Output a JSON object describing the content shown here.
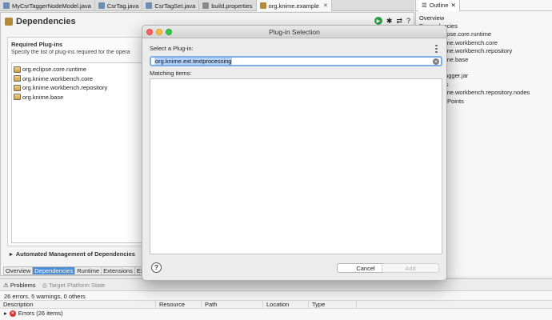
{
  "editor_tabs": [
    {
      "label": "MyCsrTaggerNodeModel.java",
      "icon": "java-file-icon"
    },
    {
      "label": "CsrTag.java",
      "icon": "java-file-icon"
    },
    {
      "label": "CsrTagSet.java",
      "icon": "java-file-icon"
    },
    {
      "label": "build.properties",
      "icon": "properties-file-icon"
    },
    {
      "label": "org.knime.example",
      "icon": "plugin-manifest-icon",
      "active": true
    }
  ],
  "editor": {
    "title": "Dependencies",
    "required_section": {
      "title": "Required Plug-ins",
      "description": "Specify the list of plug-ins required for the opera",
      "plugins": [
        "org.eclipse.core.runtime",
        "org.knime.workbench.core",
        "org.knime.workbench.repository",
        "org.knime.base"
      ]
    },
    "auto_management": "Automated Management of Dependencies",
    "page_tabs": [
      "Overview",
      "Dependencies",
      "Runtime",
      "Extensions",
      "Ex"
    ]
  },
  "outline": {
    "tab_label": "Outline",
    "nodes": [
      {
        "label": "Overview",
        "level": 1
      },
      {
        "label": "Dependencies",
        "level": 1
      },
      {
        "label": "org.eclipse.core.runtime",
        "level": 2
      },
      {
        "label": "org.knime.workbench.core",
        "level": 2
      },
      {
        "label": "org.knime.workbench.repository",
        "level": 2
      },
      {
        "label": "org.knime.base",
        "level": 2
      },
      {
        "label": "Runtime",
        "level": 1
      },
      {
        "label": "mycsrtagger.jar",
        "level": 2
      },
      {
        "label": "Extensions",
        "level": 1
      },
      {
        "label": "org.knime.workbench.repository.nodes",
        "level": 2
      },
      {
        "label": "Extension Points",
        "level": 1
      }
    ]
  },
  "dialog": {
    "title": "Plug-in Selection",
    "select_label": "Select a Plug-in:",
    "input_value": "org.knime.ext.textprocessing",
    "matching_label": "Matching items:",
    "cancel_label": "Cancel",
    "add_label": "Add",
    "help_label": "?"
  },
  "problems": {
    "tab_label": "Problems",
    "target_platform_label": "Target Platform State",
    "summary": "26 errors, 5 warnings, 0 others",
    "columns": [
      "Description",
      "Resource",
      "Path",
      "Location",
      "Type"
    ],
    "rows": [
      {
        "label": "Errors (26 items)"
      }
    ]
  }
}
